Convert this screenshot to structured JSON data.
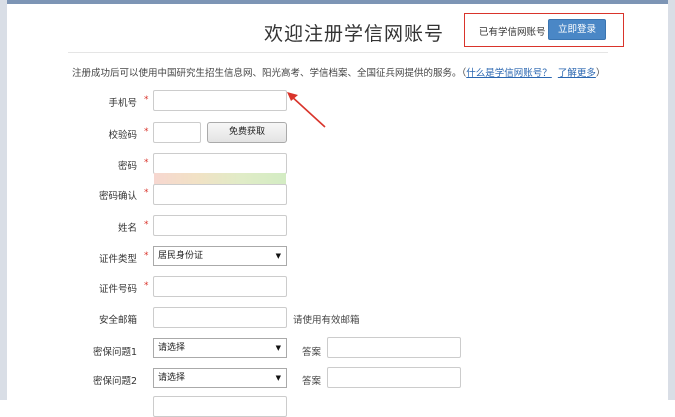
{
  "header": {
    "title": "欢迎注册学信网账号",
    "login_prompt": "已有学信网账号",
    "login_button": "立即登录"
  },
  "intro": {
    "text": "注册成功后可以使用中国研究生招生信息网、阳光高考、学信档案、全国征兵网提供的服务。",
    "paren_open": "（",
    "link_what": "什么是学信网账号？",
    "link_more": "了解更多",
    "paren_close": "）"
  },
  "form": {
    "phone_label": "手机号",
    "code_label": "校验码",
    "code_button": "免费获取",
    "password_label": "密码",
    "password_confirm_label": "密码确认",
    "name_label": "姓名",
    "id_type_label": "证件类型",
    "id_type_value": "居民身份证",
    "id_number_label": "证件号码",
    "email_label": "安全邮箱",
    "email_hint": "请使用有效邮箱",
    "q1_label": "密保问题1",
    "q1_value": "请选择",
    "q1_answer_label": "答案",
    "q2_label": "密保问题2",
    "q2_value": "请选择",
    "q2_answer_label": "答案",
    "required_mark": "*"
  },
  "colors": {
    "accent_blue": "#4a87c6",
    "highlight_red": "#d9342b",
    "link": "#2a66b0"
  }
}
